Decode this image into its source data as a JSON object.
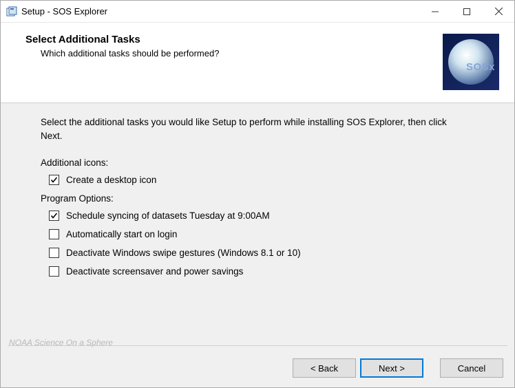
{
  "window": {
    "title": "Setup - SOS Explorer"
  },
  "header": {
    "title": "Select Additional Tasks",
    "subtitle": "Which additional tasks should be performed?",
    "logo_label": "SOSx"
  },
  "body": {
    "intro": "Select the additional tasks you would like Setup to perform while installing SOS Explorer, then click Next.",
    "groups": [
      {
        "title": "Additional icons:",
        "items": [
          {
            "label": "Create a desktop icon",
            "checked": true
          }
        ]
      },
      {
        "title": "Program Options:",
        "items": [
          {
            "label": "Schedule syncing of datasets Tuesday at 9:00AM",
            "checked": true
          },
          {
            "label": "Automatically start on login",
            "checked": false
          },
          {
            "label": "Deactivate Windows swipe gestures (Windows 8.1 or 10)",
            "checked": false
          },
          {
            "label": "Deactivate screensaver and power savings",
            "checked": false
          }
        ]
      }
    ]
  },
  "brand": "NOAA Science On a Sphere",
  "buttons": {
    "back": "< Back",
    "next": "Next >",
    "cancel": "Cancel"
  }
}
